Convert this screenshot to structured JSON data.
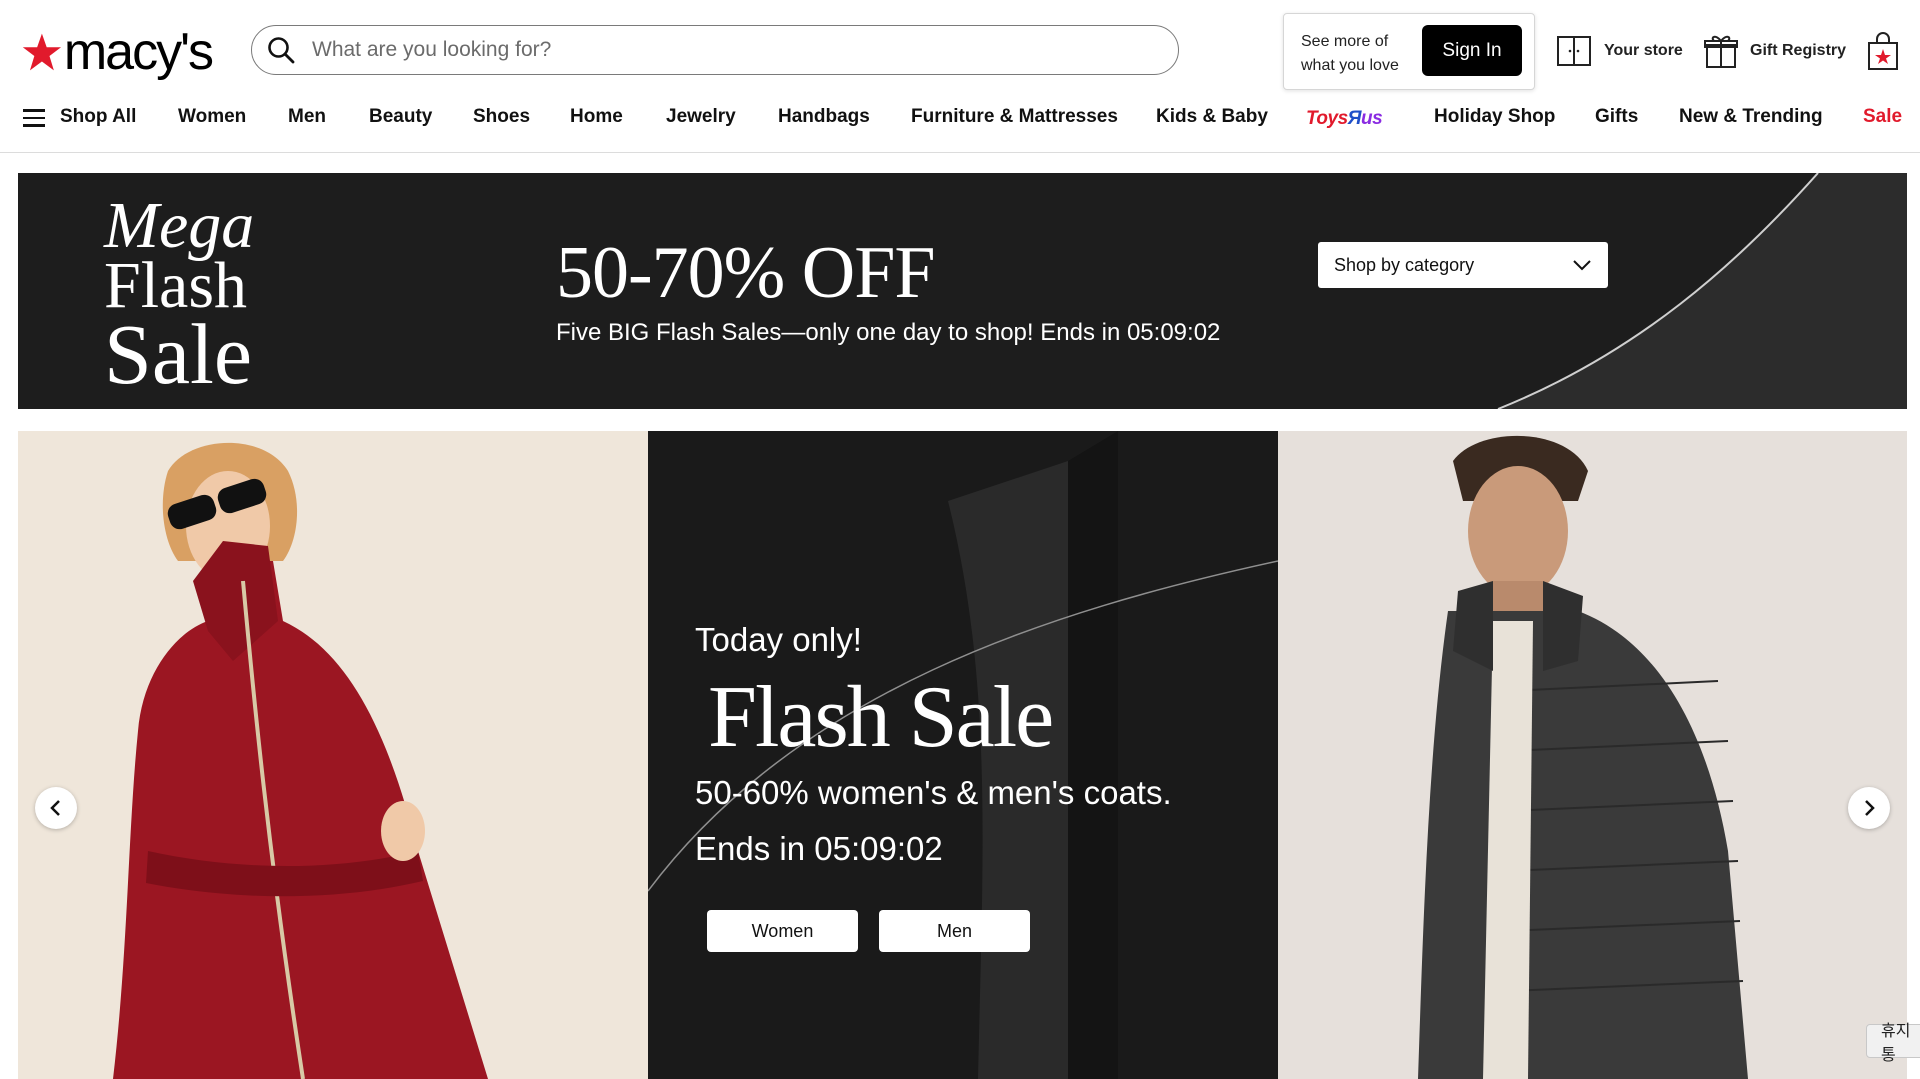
{
  "brand": {
    "logo_text": "macy's"
  },
  "search": {
    "placeholder": "What are you looking for?"
  },
  "account": {
    "prompt": "See more of what you love",
    "signin_label": "Sign In"
  },
  "utilities": {
    "store_label": "Your store",
    "registry_label": "Gift Registry"
  },
  "nav": {
    "shop_all": "Shop All",
    "items": [
      "Women",
      "Men",
      "Beauty",
      "Shoes",
      "Home",
      "Jewelry",
      "Handbags",
      "Furniture & Mattresses",
      "Kids & Baby"
    ],
    "toysrus": "ToysЯus",
    "items2": [
      "Holiday Shop",
      "Gifts",
      "New & Trending"
    ],
    "sale": "Sale"
  },
  "promo": {
    "mega_1": "Mega",
    "mega_2": "Flash",
    "mega_3": "Sale",
    "headline": "50-70% OFF",
    "subline": "Five BIG Flash Sales—only one day to shop! Ends in 05:09:02",
    "category_select": "Shop by category"
  },
  "hero": {
    "eyebrow": "Today only!",
    "title": "Flash Sale",
    "description": "50-60% women's & men's coats.",
    "countdown": "Ends in 05:09:02",
    "btn_women": "Women",
    "btn_men": "Men"
  },
  "corner_chip": "휴지통",
  "colors": {
    "brand_red": "#e11a2c",
    "promo_bg": "#1d1d1d",
    "coat_red": "#9b1622"
  },
  "icons": [
    "macys-star-icon",
    "search-icon",
    "store-icon",
    "gift-icon",
    "shopping-bag-icon",
    "hamburger-icon",
    "chevron-down-icon",
    "chevron-left-icon",
    "chevron-right-icon"
  ]
}
